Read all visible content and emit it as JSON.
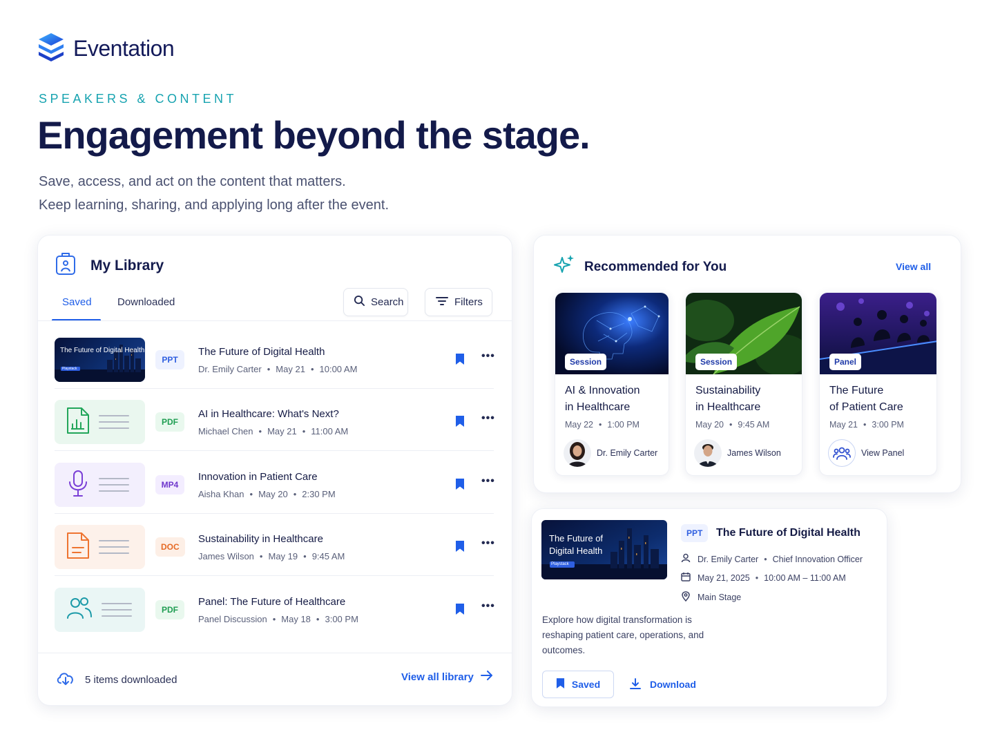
{
  "brand": {
    "name": "Eventation",
    "icon": "layers-logo-icon"
  },
  "hero": {
    "eyebrow": "SPEAKERS & CONTENT",
    "headline": "Engagement beyond the stage.",
    "sub1": "Save, access, and act on the content that matters.",
    "sub2": "Keep learning, sharing, and applying long after the event."
  },
  "library": {
    "title": "My Library",
    "tabs": [
      "Saved",
      "Downloaded"
    ],
    "search_label": "Search",
    "filters_label": "Filters",
    "items": [
      {
        "thumb_title": "The Future of Digital Health",
        "thumb_tag": "Playstack",
        "type": "PPT",
        "title": "The Future of Digital Health",
        "speaker": "Dr. Emily Carter",
        "date": "May 21",
        "time": "10:00 AM"
      },
      {
        "type": "PDF",
        "title": "AI in Healthcare: What's Next?",
        "speaker": "Michael Chen",
        "date": "May 21",
        "time": "11:00 AM"
      },
      {
        "type": "MP4",
        "title": "Innovation in Patient Care",
        "speaker": "Aisha Khan",
        "date": "May 20",
        "time": "2:30 PM"
      },
      {
        "type": "DOC",
        "title": "Sustainability in Healthcare",
        "speaker": "James Wilson",
        "date": "May 19",
        "time": "9:45 AM"
      },
      {
        "type": "PDF",
        "title": "Panel: The Future of Healthcare",
        "speaker": "Panel Discussion",
        "date": "May 18",
        "time": "3:00 PM"
      }
    ],
    "footer_status": "5 items downloaded",
    "footer_link": "View all library"
  },
  "recommended": {
    "title": "Recommended for You",
    "view_all": "View all",
    "cards": [
      {
        "tag": "Session",
        "title1": "AI & Innovation",
        "title2": "in Healthcare",
        "date": "May 22",
        "time": "1:00 PM",
        "person": "Dr. Emily Carter"
      },
      {
        "tag": "Session",
        "title1": "Sustainability",
        "title2": "in Healthcare",
        "date": "May 20",
        "time": "9:45 AM",
        "person": "James Wilson"
      },
      {
        "tag": "Panel",
        "title1": "The Future",
        "title2": "of Patient Care",
        "date": "May 21",
        "time": "3:00 PM",
        "person": "View Panel"
      }
    ]
  },
  "detail": {
    "thumb_title1": "The Future of",
    "thumb_title2": "Digital Health",
    "thumb_tag": "Playstack",
    "type": "PPT",
    "title": "The Future of Digital Health",
    "speaker": "Dr. Emily Carter",
    "role": "Chief Innovation Officer",
    "date": "May 21, 2025",
    "time": "10:00 AM – 11:00 AM",
    "location": "Main Stage",
    "description": "Explore how digital transformation is reshaping patient care, operations, and outcomes.",
    "saved_label": "Saved",
    "download_label": "Download"
  },
  "colors": {
    "accent": "#1f5ee8",
    "teal": "#17a3b0",
    "navy": "#131a4a"
  }
}
